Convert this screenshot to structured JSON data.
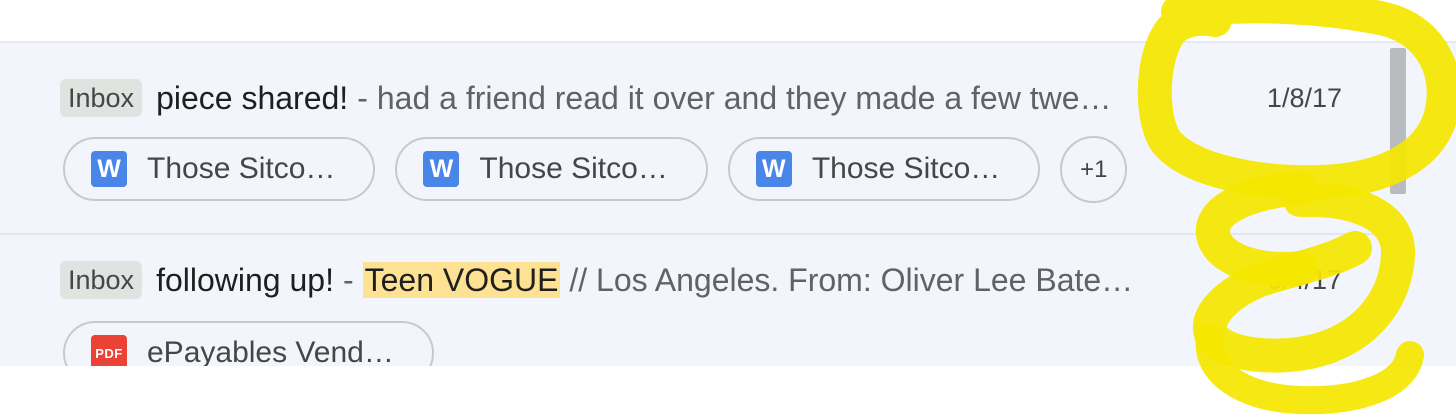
{
  "emails": [
    {
      "label": "Inbox",
      "subject": "piece shared!",
      "separator": "-",
      "snippet": "had a friend read it over and they made a few twe…",
      "date": "1/8/17",
      "attachments": [
        {
          "type": "doc",
          "icon_letter": "W",
          "name": "Those Sitco…"
        },
        {
          "type": "doc",
          "icon_letter": "W",
          "name": "Those Sitco…"
        },
        {
          "type": "doc",
          "icon_letter": "W",
          "name": "Those Sitco…"
        }
      ],
      "more_count": "+1"
    },
    {
      "label": "Inbox",
      "subject": "following up!",
      "separator": "-",
      "snippet_highlight": "Teen VOGUE",
      "snippet_rest": " // Los Angeles. From: Oliver Lee Bate…",
      "date": "6/4/17",
      "attachments": [
        {
          "type": "pdf",
          "icon_letter": "PDF",
          "name": "ePayables Vend…"
        }
      ]
    }
  ],
  "colors": {
    "row_background": "#f2f5fb",
    "highlight": "#fde293",
    "annotation": "#f5e600",
    "doc_icon": "#4a86e8",
    "pdf_icon": "#ea4335"
  }
}
